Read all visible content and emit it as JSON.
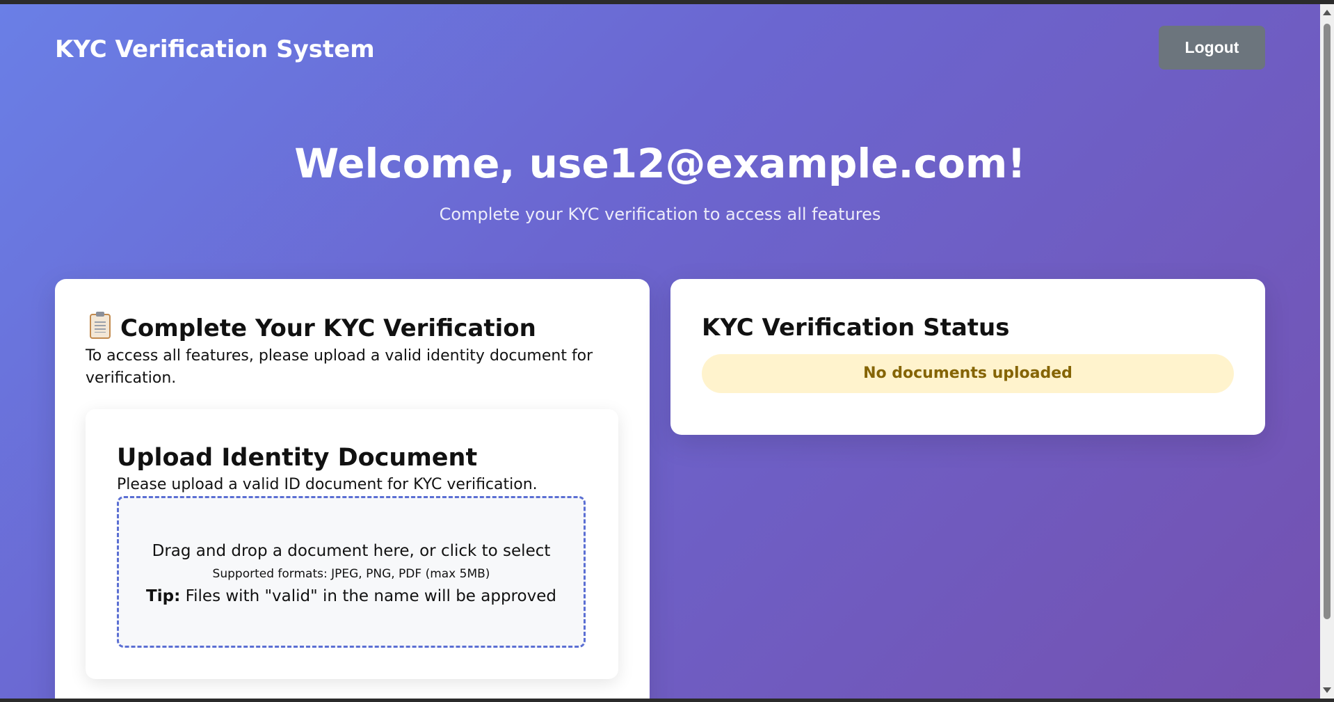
{
  "header": {
    "app_title": "KYC Verification System",
    "logout_label": "Logout"
  },
  "welcome": {
    "title": "Welcome, use12@example.com!",
    "subtitle": "Complete your KYC verification to access all features"
  },
  "kyc_card": {
    "icon": "clipboard-icon",
    "title": "Complete Your KYC Verification",
    "description": "To access all features, please upload a valid identity document for verification."
  },
  "upload": {
    "title": "Upload Identity Document",
    "description": "Please upload a valid ID document for KYC verification.",
    "drop_text": "Drag and drop a document here, or click to select",
    "formats_text": "Supported formats: JPEG, PNG, PDF (max 5MB)",
    "tip_label": "Tip:",
    "tip_text": " Files with \"valid\" in the name will be approved"
  },
  "status_card": {
    "title": "KYC Verification Status",
    "status_text": "No documents uploaded"
  },
  "colors": {
    "gradient_start": "#6a7fe6",
    "gradient_end": "#7451b0",
    "logout_bg": "#6c757d",
    "status_bg": "#fff3cd",
    "status_text": "#856404",
    "dropzone_border": "#5b6fd3"
  }
}
